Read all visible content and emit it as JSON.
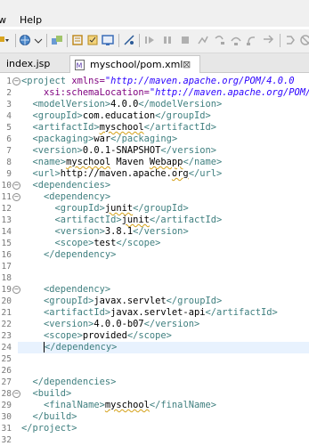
{
  "menu": {
    "window_fragment": "w",
    "help": "Help"
  },
  "tabs": [
    {
      "label": "index.jsp",
      "active": false
    },
    {
      "label": "myschool/pom.xml",
      "active": true,
      "close_glyph": "⊠"
    }
  ],
  "toolbar": {
    "icons": [
      "dropdown-arrow-icon",
      "globe-icon",
      "new-java-icon",
      "open-type-icon",
      "task-icon",
      "window-icon",
      "breakpoint-icon",
      "resume-icon",
      "suspend-icon",
      "terminate-icon",
      "disconnect-icon",
      "step-into-icon",
      "step-over-icon",
      "step-return-icon",
      "drop-to-frame-icon"
    ]
  },
  "colors": {
    "tag": "#3f7f7f",
    "attr": "#7f007f",
    "value": "#2a00ff",
    "text": "#000000",
    "current_line": "#e8f2fe"
  },
  "editor": {
    "line_numbers": [
      "1",
      "2",
      "3",
      "4",
      "5",
      "6",
      "7",
      "8",
      "9",
      "10",
      "11",
      "12",
      "13",
      "14",
      "15",
      "16",
      "17",
      "18",
      "19",
      "20",
      "21",
      "22",
      "23",
      "24",
      "25",
      "26",
      "27",
      "28",
      "29",
      "30",
      "31",
      "32"
    ],
    "fold_lines": [
      "1",
      "10",
      "11",
      "19",
      "28"
    ],
    "current_line": "24",
    "lines": [
      [
        {
          "t": "tag",
          "s": "<project "
        },
        {
          "t": "attr",
          "s": "xmlns="
        },
        {
          "t": "val",
          "s": "\"http://maven.apache.org/POM/4.0.0"
        }
      ],
      [
        {
          "t": "txt",
          "s": "    "
        },
        {
          "t": "attr",
          "s": "xsi:schemaLocation="
        },
        {
          "t": "val",
          "s": "\"http://maven.apache.org/POM/"
        }
      ],
      [
        {
          "t": "txt",
          "s": "  "
        },
        {
          "t": "tag",
          "s": "<modelVersion>"
        },
        {
          "t": "txt",
          "s": "4.0.0"
        },
        {
          "t": "tag",
          "s": "</modelVersion>"
        }
      ],
      [
        {
          "t": "txt",
          "s": "  "
        },
        {
          "t": "tag",
          "s": "<groupId>"
        },
        {
          "t": "txt",
          "s": "com.education"
        },
        {
          "t": "tag",
          "s": "</groupId>"
        }
      ],
      [
        {
          "t": "txt",
          "s": "  "
        },
        {
          "t": "tag",
          "s": "<artifactId>"
        },
        {
          "t": "sq",
          "s": "myschool"
        },
        {
          "t": "tag",
          "s": "</artifactId>"
        }
      ],
      [
        {
          "t": "txt",
          "s": "  "
        },
        {
          "t": "tag",
          "s": "<packaging>"
        },
        {
          "t": "txt",
          "s": "war"
        },
        {
          "t": "tag",
          "s": "</packaging>"
        }
      ],
      [
        {
          "t": "txt",
          "s": "  "
        },
        {
          "t": "tag",
          "s": "<version>"
        },
        {
          "t": "txt",
          "s": "0.0.1-SNAPSHOT"
        },
        {
          "t": "tag",
          "s": "</version>"
        }
      ],
      [
        {
          "t": "txt",
          "s": "  "
        },
        {
          "t": "tag",
          "s": "<name>"
        },
        {
          "t": "sq",
          "s": "myschool"
        },
        {
          "t": "txt",
          "s": " Maven "
        },
        {
          "t": "sq",
          "s": "Webapp"
        },
        {
          "t": "tag",
          "s": "</name>"
        }
      ],
      [
        {
          "t": "txt",
          "s": "  "
        },
        {
          "t": "tag",
          "s": "<url>"
        },
        {
          "t": "txt",
          "s": "http://maven.apache."
        },
        {
          "t": "sq",
          "s": "org"
        },
        {
          "t": "tag",
          "s": "</url>"
        }
      ],
      [
        {
          "t": "txt",
          "s": "  "
        },
        {
          "t": "tag",
          "s": "<dependencies>"
        }
      ],
      [
        {
          "t": "txt",
          "s": "    "
        },
        {
          "t": "tag",
          "s": "<dependency>"
        }
      ],
      [
        {
          "t": "txt",
          "s": "      "
        },
        {
          "t": "tag",
          "s": "<groupId>"
        },
        {
          "t": "sq",
          "s": "junit"
        },
        {
          "t": "tag",
          "s": "</groupId>"
        }
      ],
      [
        {
          "t": "txt",
          "s": "      "
        },
        {
          "t": "tag",
          "s": "<artifactId>"
        },
        {
          "t": "sq",
          "s": "junit"
        },
        {
          "t": "tag",
          "s": "</artifactId>"
        }
      ],
      [
        {
          "t": "txt",
          "s": "      "
        },
        {
          "t": "tag",
          "s": "<version>"
        },
        {
          "t": "txt",
          "s": "3.8.1"
        },
        {
          "t": "tag",
          "s": "</version>"
        }
      ],
      [
        {
          "t": "txt",
          "s": "      "
        },
        {
          "t": "tag",
          "s": "<scope>"
        },
        {
          "t": "txt",
          "s": "test"
        },
        {
          "t": "tag",
          "s": "</scope>"
        }
      ],
      [
        {
          "t": "txt",
          "s": "    "
        },
        {
          "t": "tag",
          "s": "</dependency>"
        }
      ],
      [],
      [],
      [
        {
          "t": "txt",
          "s": "    "
        },
        {
          "t": "tag",
          "s": "<dependency>"
        }
      ],
      [
        {
          "t": "txt",
          "s": "    "
        },
        {
          "t": "tag",
          "s": "<groupId>"
        },
        {
          "t": "txt",
          "s": "javax.servlet"
        },
        {
          "t": "tag",
          "s": "</groupId>"
        }
      ],
      [
        {
          "t": "txt",
          "s": "    "
        },
        {
          "t": "tag",
          "s": "<artifactId>"
        },
        {
          "t": "txt",
          "s": "javax.servlet-api"
        },
        {
          "t": "tag",
          "s": "</artifactId>"
        }
      ],
      [
        {
          "t": "txt",
          "s": "    "
        },
        {
          "t": "tag",
          "s": "<version>"
        },
        {
          "t": "txt",
          "s": "4.0.0-b07"
        },
        {
          "t": "tag",
          "s": "</version>"
        }
      ],
      [
        {
          "t": "txt",
          "s": "    "
        },
        {
          "t": "tag",
          "s": "<scope>"
        },
        {
          "t": "txt",
          "s": "provided"
        },
        {
          "t": "tag",
          "s": "</scope>"
        }
      ],
      [
        {
          "t": "txt",
          "s": "    "
        },
        {
          "t": "caret",
          "s": ""
        },
        {
          "t": "tag",
          "s": "</dependency>"
        }
      ],
      [],
      [],
      [
        {
          "t": "txt",
          "s": "  "
        },
        {
          "t": "tag",
          "s": "</dependencies>"
        }
      ],
      [
        {
          "t": "txt",
          "s": "  "
        },
        {
          "t": "tag",
          "s": "<build>"
        }
      ],
      [
        {
          "t": "txt",
          "s": "    "
        },
        {
          "t": "tag",
          "s": "<finalName>"
        },
        {
          "t": "sq",
          "s": "myschool"
        },
        {
          "t": "tag",
          "s": "</finalName>"
        }
      ],
      [
        {
          "t": "txt",
          "s": "  "
        },
        {
          "t": "tag",
          "s": "</build>"
        }
      ],
      [
        {
          "t": "tag",
          "s": "</project>"
        }
      ],
      []
    ]
  }
}
